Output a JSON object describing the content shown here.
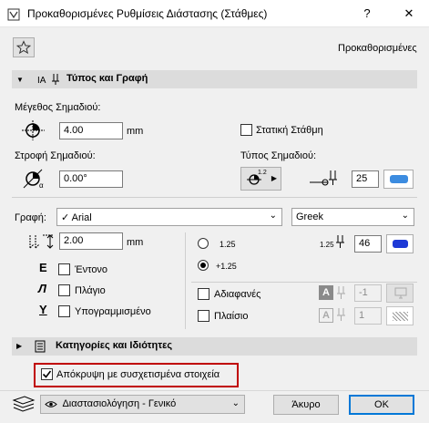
{
  "window": {
    "title": "Προκαθορισμένες Ρυθμίσεις Διάστασης (Στάθμες)",
    "help": "?",
    "close": "✕"
  },
  "header": {
    "preset_label": "Προκαθορισμένες"
  },
  "type_section": {
    "title": "Τύπος και Γραφή",
    "marker_size_label": "Μέγεθος Σημαδιού:",
    "marker_size_value": "4.00",
    "marker_size_unit": "mm",
    "static_level_label": "Στατική Στάθμη",
    "marker_rotation_label": "Στροφή Σημαδιού:",
    "marker_rotation_value": "0.00°",
    "marker_type_label": "Τύπος Σημαδιού:",
    "pen_value": "25",
    "marker_preview_text": "1.2",
    "font_label": "Γραφή:",
    "font_value": "Arial",
    "font_check": "✓",
    "script_value": "Greek",
    "text_size_value": "2.00",
    "text_size_unit": "mm",
    "bold_label": "Έντονο",
    "italic_label": "Πλάγιο",
    "underline_label": "Υπογραμμισμένο",
    "radio_1_label": "1.25",
    "radio_2_label": "+1.25",
    "text_pen_sample": "1.25",
    "text_pen_value": "46",
    "transparent_label": "Αδιαφανές",
    "transparent_value": "-1",
    "frame_label": "Πλαίσιο",
    "frame_value": "1",
    "icon_a": "A"
  },
  "categories_section": {
    "title": "Κατηγορίες και Ιδιότητες"
  },
  "footer": {
    "hide_label": "Απόκρυψη με συσχετισμένα στοιχεία",
    "layer_value": "Διαστασιολόγηση - Γενικό",
    "cancel": "Άκυρο",
    "ok": "OK"
  },
  "colors": {
    "accent": "#0078d7",
    "highlight_border": "#c00000",
    "pen_blue": "#1e3ad6"
  }
}
